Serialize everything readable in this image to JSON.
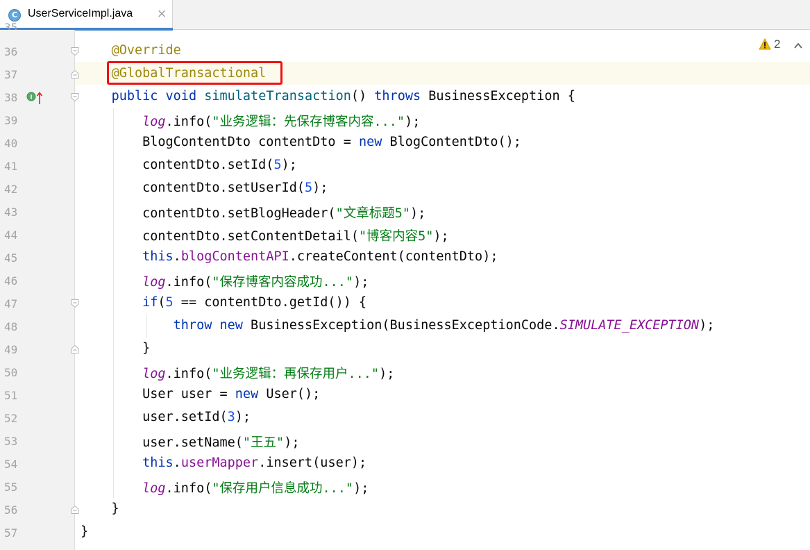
{
  "tab": {
    "icon_letter": "C",
    "title": "UserServiceImpl.java",
    "close": "×"
  },
  "inspection": {
    "warning_count": "2",
    "icon": "warning-triangle-icon",
    "chevron": "chevron-up-icon"
  },
  "highlight_box_color": "#ee1111",
  "partial_top_line": "35",
  "lines": [
    {
      "n": "36",
      "fold": "open",
      "tokens": [
        {
          "t": "    ",
          "c": ""
        },
        {
          "t": "@Override",
          "c": "tk-ann"
        }
      ]
    },
    {
      "n": "37",
      "fold": "close",
      "tokens": [
        {
          "t": "    ",
          "c": ""
        },
        {
          "t": "@GlobalTransactional",
          "c": "tk-ann"
        }
      ]
    },
    {
      "n": "38",
      "fold": "open",
      "tokens": [
        {
          "t": "    ",
          "c": ""
        },
        {
          "t": "public",
          "c": "tk-kw"
        },
        {
          "t": " ",
          "c": ""
        },
        {
          "t": "void",
          "c": "tk-kw"
        },
        {
          "t": " ",
          "c": ""
        },
        {
          "t": "simulateTransaction",
          "c": "tk-fn"
        },
        {
          "t": "() ",
          "c": ""
        },
        {
          "t": "throws",
          "c": "tk-kw"
        },
        {
          "t": " BusinessException {",
          "c": ""
        }
      ]
    },
    {
      "n": "39",
      "fold": "",
      "tokens": [
        {
          "t": "        ",
          "c": ""
        },
        {
          "t": "log",
          "c": "tk-log"
        },
        {
          "t": ".info(",
          "c": ""
        },
        {
          "t": "\"业务逻辑：先保存博客内容...\"",
          "c": "tk-str"
        },
        {
          "t": ");",
          "c": ""
        }
      ]
    },
    {
      "n": "40",
      "fold": "",
      "tokens": [
        {
          "t": "        BlogContentDto contentDto = ",
          "c": ""
        },
        {
          "t": "new",
          "c": "tk-kw"
        },
        {
          "t": " BlogContentDto();",
          "c": ""
        }
      ]
    },
    {
      "n": "41",
      "fold": "",
      "tokens": [
        {
          "t": "        contentDto.setId(",
          "c": ""
        },
        {
          "t": "5",
          "c": "tk-num"
        },
        {
          "t": ");",
          "c": ""
        }
      ]
    },
    {
      "n": "42",
      "fold": "",
      "tokens": [
        {
          "t": "        contentDto.setUserId(",
          "c": ""
        },
        {
          "t": "5",
          "c": "tk-num"
        },
        {
          "t": ");",
          "c": ""
        }
      ]
    },
    {
      "n": "43",
      "fold": "",
      "tokens": [
        {
          "t": "        contentDto.setBlogHeader(",
          "c": ""
        },
        {
          "t": "\"文章标题5\"",
          "c": "tk-str"
        },
        {
          "t": ");",
          "c": ""
        }
      ]
    },
    {
      "n": "44",
      "fold": "",
      "tokens": [
        {
          "t": "        contentDto.setContentDetail(",
          "c": ""
        },
        {
          "t": "\"博客内容5\"",
          "c": "tk-str"
        },
        {
          "t": ");",
          "c": ""
        }
      ]
    },
    {
      "n": "45",
      "fold": "",
      "tokens": [
        {
          "t": "        ",
          "c": ""
        },
        {
          "t": "this",
          "c": "tk-kw"
        },
        {
          "t": ".",
          "c": ""
        },
        {
          "t": "blogContentAPI",
          "c": "tk-field"
        },
        {
          "t": ".createContent(contentDto);",
          "c": ""
        }
      ]
    },
    {
      "n": "46",
      "fold": "",
      "tokens": [
        {
          "t": "        ",
          "c": ""
        },
        {
          "t": "log",
          "c": "tk-log"
        },
        {
          "t": ".info(",
          "c": ""
        },
        {
          "t": "\"保存博客内容成功...\"",
          "c": "tk-str"
        },
        {
          "t": ");",
          "c": ""
        }
      ]
    },
    {
      "n": "47",
      "fold": "open",
      "tokens": [
        {
          "t": "        ",
          "c": ""
        },
        {
          "t": "if",
          "c": "tk-kw"
        },
        {
          "t": "(",
          "c": ""
        },
        {
          "t": "5",
          "c": "tk-num"
        },
        {
          "t": " == contentDto.getId()) {",
          "c": ""
        }
      ]
    },
    {
      "n": "48",
      "fold": "",
      "tokens": [
        {
          "t": "            ",
          "c": ""
        },
        {
          "t": "throw",
          "c": "tk-kw"
        },
        {
          "t": " ",
          "c": ""
        },
        {
          "t": "new",
          "c": "tk-kw"
        },
        {
          "t": " BusinessException(BusinessExceptionCode.",
          "c": ""
        },
        {
          "t": "SIMULATE_EXCEPTION",
          "c": "tk-static"
        },
        {
          "t": ");",
          "c": ""
        }
      ]
    },
    {
      "n": "49",
      "fold": "close",
      "tokens": [
        {
          "t": "        }",
          "c": ""
        }
      ]
    },
    {
      "n": "50",
      "fold": "",
      "tokens": [
        {
          "t": "        ",
          "c": ""
        },
        {
          "t": "log",
          "c": "tk-log"
        },
        {
          "t": ".info(",
          "c": ""
        },
        {
          "t": "\"业务逻辑：再保存用户...\"",
          "c": "tk-str"
        },
        {
          "t": ");",
          "c": ""
        }
      ]
    },
    {
      "n": "51",
      "fold": "",
      "tokens": [
        {
          "t": "        User user = ",
          "c": ""
        },
        {
          "t": "new",
          "c": "tk-kw"
        },
        {
          "t": " User();",
          "c": ""
        }
      ]
    },
    {
      "n": "52",
      "fold": "",
      "tokens": [
        {
          "t": "        user.setId(",
          "c": ""
        },
        {
          "t": "3",
          "c": "tk-num"
        },
        {
          "t": ");",
          "c": ""
        }
      ]
    },
    {
      "n": "53",
      "fold": "",
      "tokens": [
        {
          "t": "        user.setName(",
          "c": ""
        },
        {
          "t": "\"王五\"",
          "c": "tk-str"
        },
        {
          "t": ");",
          "c": ""
        }
      ]
    },
    {
      "n": "54",
      "fold": "",
      "tokens": [
        {
          "t": "        ",
          "c": ""
        },
        {
          "t": "this",
          "c": "tk-kw"
        },
        {
          "t": ".",
          "c": ""
        },
        {
          "t": "userMapper",
          "c": "tk-field"
        },
        {
          "t": ".insert(user);",
          "c": ""
        }
      ]
    },
    {
      "n": "55",
      "fold": "",
      "tokens": [
        {
          "t": "        ",
          "c": ""
        },
        {
          "t": "log",
          "c": "tk-log"
        },
        {
          "t": ".info(",
          "c": ""
        },
        {
          "t": "\"保存用户信息成功...\"",
          "c": "tk-str"
        },
        {
          "t": ");",
          "c": ""
        }
      ]
    },
    {
      "n": "56",
      "fold": "close",
      "tokens": [
        {
          "t": "    }",
          "c": ""
        }
      ]
    },
    {
      "n": "57",
      "fold": "",
      "tokens": [
        {
          "t": "}",
          "c": ""
        }
      ]
    }
  ]
}
